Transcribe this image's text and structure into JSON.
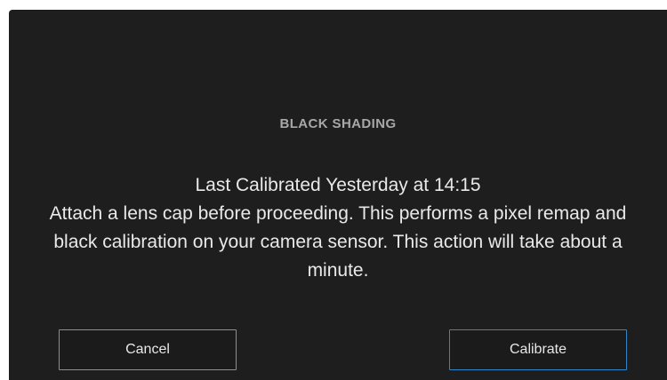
{
  "dialog": {
    "title": "BLACK SHADING",
    "last_calibrated": "Last Calibrated Yesterday at 14:15",
    "instructions": "Attach a lens cap before proceeding. This performs a pixel remap and black calibration on your camera sensor. This action will take about a minute.",
    "cancel_label": "Cancel",
    "calibrate_label": "Calibrate"
  },
  "colors": {
    "background": "#1e1e1e",
    "accent": "#2f86c8"
  }
}
